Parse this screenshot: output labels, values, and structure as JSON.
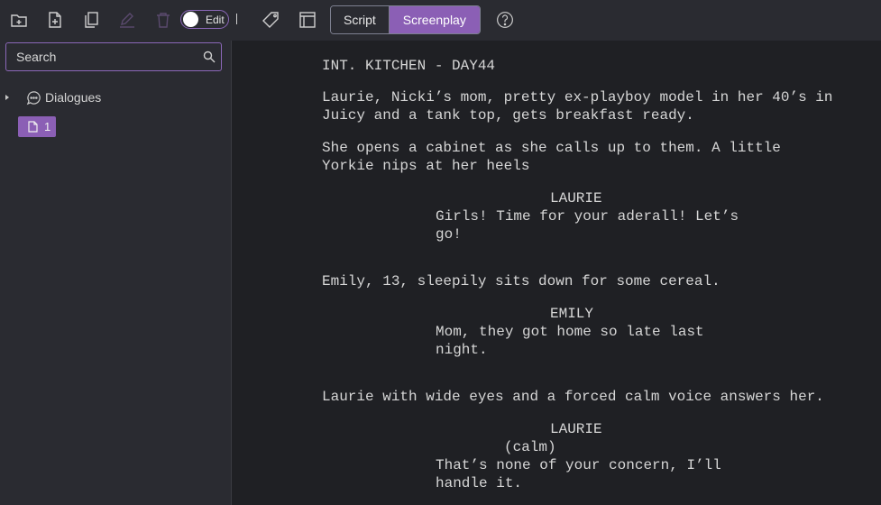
{
  "toolbar": {
    "icons": [
      "new-folder-icon",
      "new-file-icon",
      "copy-icon",
      "edit-pencil-icon",
      "trash-icon",
      "tag-icon",
      "layout-icon",
      "help-icon"
    ],
    "edit_toggle_label": "Edit",
    "view_options": [
      "Script",
      "Screenplay"
    ],
    "active_view": "Screenplay",
    "help_label": "?"
  },
  "sidebar": {
    "search_placeholder": "Search",
    "tree": {
      "folder_label": "Dialogues",
      "selected_item_label": "1"
    }
  },
  "script": {
    "scene_heading": "INT. KITCHEN - DAY44",
    "action1": [
      "Laurie, Nicki’s mom, pretty ex-playboy model in her 40’s in",
      "Juicy and a tank top, gets breakfast ready."
    ],
    "action2": [
      "She opens a cabinet as she calls up to them. A little",
      "Yorkie nips at her heels"
    ],
    "char1": "LAURIE",
    "dialogue1": [
      "Girls! Time for your aderall! Let’s",
      "go!"
    ],
    "action3": "Emily, 13, sleepily sits down for some cereal.",
    "char2": "EMILY",
    "dialogue2": [
      "Mom, they got home so late last",
      "night."
    ],
    "action4": "Laurie with wide eyes and a forced calm voice answers her.",
    "char3": "LAURIE",
    "paren3": "(calm)",
    "dialogue3": [
      "That’s none of your concern, I’ll",
      "handle it."
    ]
  },
  "colors": {
    "accent": "#8b5fb5",
    "toolbar_bg": "#2a2b31",
    "editor_bg": "#1f2024",
    "text": "#d6d6d6"
  }
}
